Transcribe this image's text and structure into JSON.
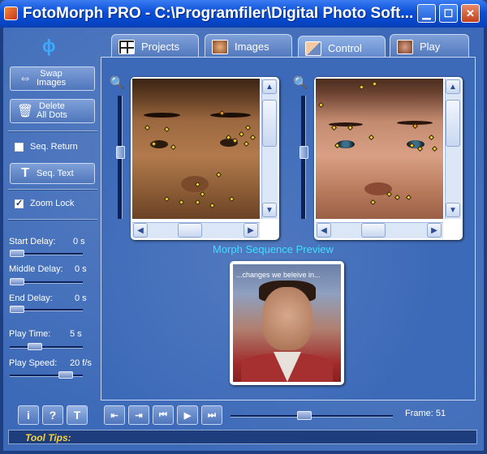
{
  "window": {
    "title": "FotoMorph PRO - C:\\Programfiler\\Digital Photo Soft...",
    "controls": [
      "minimize",
      "maximize",
      "close"
    ]
  },
  "tabs": [
    {
      "label": "Projects",
      "icon": "projects-icon"
    },
    {
      "label": "Images",
      "icon": "images-icon"
    },
    {
      "label": "Control",
      "icon": "control-icon"
    },
    {
      "label": "Play",
      "icon": "play-tab-icon"
    }
  ],
  "sidebar": {
    "swap_label": "Swap\nImages",
    "delete_label": "Delete\nAll Dots",
    "seq_return_label": "Seq. Return",
    "seq_return_checked": false,
    "seq_text_label": "Seq. Text",
    "zoom_lock_label": "Zoom Lock",
    "zoom_lock_checked": true,
    "start_delay_label": "Start Delay:",
    "start_delay_value": "0 s",
    "middle_delay_label": "Middle Delay:",
    "middle_delay_value": "0 s",
    "end_delay_label": "End Delay:",
    "end_delay_value": "0 s",
    "play_time_label": "Play Time:",
    "play_time_value": "5 s",
    "play_speed_label": "Play Speed:",
    "play_speed_value": "20 f/s"
  },
  "preview": {
    "label": "Morph Sequence Preview",
    "caption": "...changes we beleive in..."
  },
  "bottom": {
    "frame_label": "Frame: 51",
    "frame_fraction": 0.5,
    "buttons": [
      "info",
      "help",
      "text",
      "loop-back",
      "loop-forward",
      "first-frame",
      "play",
      "last-frame"
    ]
  },
  "status": {
    "tool_tips_label": "Tool Tips:"
  },
  "colors": {
    "accent": "#3ee0ff",
    "tooltip": "#f4d23b",
    "dot": "#f1d23b"
  }
}
